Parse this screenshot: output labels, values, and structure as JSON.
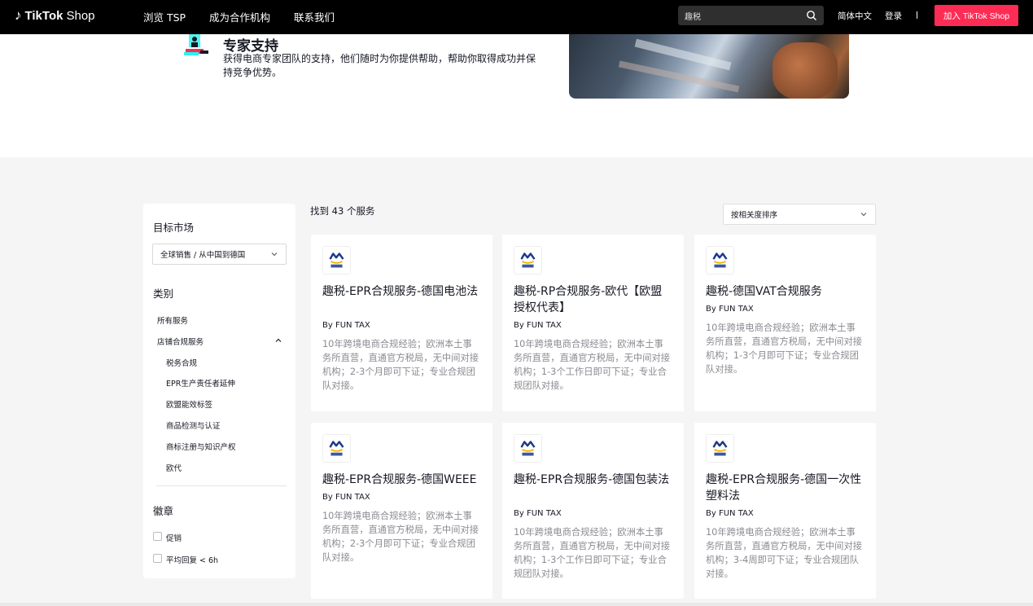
{
  "nav": {
    "logo_brand": "TikTok",
    "logo_shop": "Shop",
    "links": [
      "浏览 TSP",
      "成为合作机构",
      "联系我们"
    ],
    "search_value": "趣税",
    "language": "简体中文",
    "login": "登录",
    "join_button": "加入 TikTok Shop"
  },
  "hero": {
    "title": "专家支持",
    "description": "获得电商专家团队的支持，他们随时为你提供帮助，帮助你取得成功并保持竞争优势。"
  },
  "sidebar": {
    "market_heading": "目标市场",
    "market_value": "全球销售 / 从中国到德国",
    "category_heading": "类别",
    "all_services": "所有服务",
    "store_compliance": "店铺合规服务",
    "subcategories": [
      "税务合规",
      "EPR生产责任者延伸",
      "欧盟能效标签",
      "商品检测与认证",
      "商标注册与知识产权",
      "欧代"
    ],
    "badge_heading": "徽章",
    "badges": [
      "促销",
      "平均回复 < 6h"
    ]
  },
  "results": {
    "found_text": "找到 43 个服务",
    "sort_value": "按相关度排序",
    "cards": [
      {
        "title": "趣税-EPR合规服务-德国电池法",
        "by": "By FUN TAX",
        "desc": "10年跨境电商合规经验；欧洲本土事务所直营，直通官方税局，无中间对接机构；2-3个月即可下证；专业合规团队对接。"
      },
      {
        "title": "趣税-RP合规服务-欧代【欧盟授权代表】",
        "by": "By FUN TAX",
        "desc": "10年跨境电商合规经验；欧洲本土事务所直营，直通官方税局，无中间对接机构；1-3个工作日即可下证；专业合规团队对接。"
      },
      {
        "title": "趣税-德国VAT合规服务",
        "by": "By FUN TAX",
        "desc": "10年跨境电商合规经验；欧洲本土事务所直营，直通官方税局，无中间对接机构；1-3个月即可下证；专业合规团队对接。"
      },
      {
        "title": "趣税-EPR合规服务-德国WEEE",
        "by": "By FUN TAX",
        "desc": "10年跨境电商合规经验；欧洲本土事务所直营，直通官方税局，无中间对接机构；2-3个月即可下证；专业合规团队对接。"
      },
      {
        "title": "趣税-EPR合规服务-德国包装法",
        "by": "By FUN TAX",
        "desc": "10年跨境电商合规经验；欧洲本土事务所直营，直通官方税局，无中间对接机构；1-3个工作日即可下证；专业合规团队对接。"
      },
      {
        "title": "趣税-EPR合规服务-德国一次性塑料法",
        "by": "By FUN TAX",
        "desc": "10年跨境电商合规经验；欧洲本土事务所直营，直通官方税局，无中间对接机构；3-4周即可下证；专业合规团队对接。"
      }
    ]
  },
  "colors": {
    "accent": "#fe2c55",
    "nav_bg": "#000000",
    "page_bg": "#f5f5f5",
    "muted_text": "#8a8b91"
  }
}
